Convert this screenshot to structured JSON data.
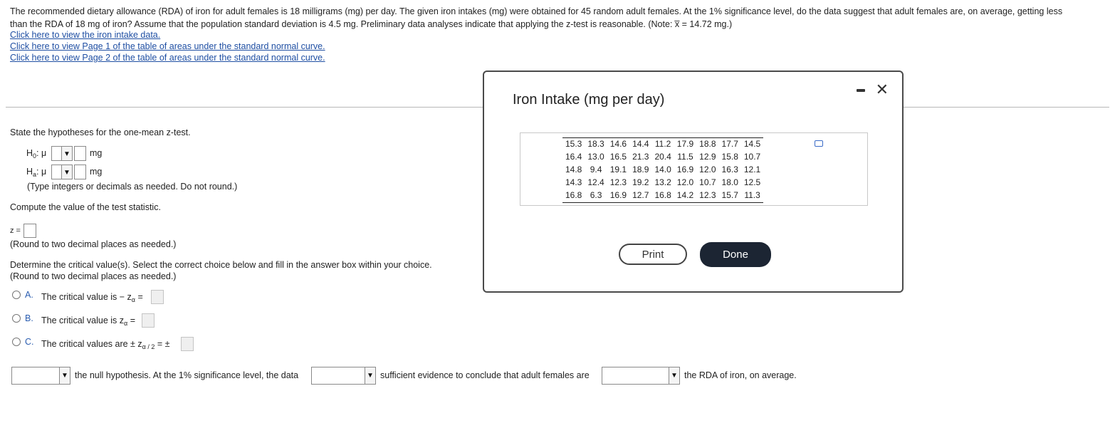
{
  "problem": {
    "text_line1": "The recommended dietary allowance (RDA) of iron for adult females is 18 milligrams (mg) per day. The given iron intakes (mg) were obtained for 45 random adult females. At the 1% significance level, do the data suggest that adult females are, on average, getting less",
    "text_line2": "than the RDA of 18 mg of iron? Assume that the population standard deviation is 4.5 mg. Preliminary data analyses indicate that applying the z-test is reasonable. (Note: x̅ = 14.72 mg.)",
    "links": [
      "Click here to view the iron intake data.",
      "Click here to view Page 1 of the table of areas under the standard normal curve.",
      "Click here to view Page 2 of the table of areas under the standard normal curve."
    ]
  },
  "hypotheses": {
    "prompt": "State the hypotheses for the one-mean z-test.",
    "h0_label": "H",
    "h0_sub": "0",
    "ha_label": "H",
    "ha_sub": "a",
    "mu_symbol": ": μ",
    "unit": "mg",
    "note": "(Type integers or decimals as needed. Do not round.)"
  },
  "test_statistic": {
    "prompt": "Compute the value of the test statistic.",
    "label": "z =",
    "note": "(Round to two decimal places as needed.)"
  },
  "critical": {
    "prompt": "Determine the critical value(s). Select the correct choice below and fill in the answer box within your choice.",
    "note": "(Round to two decimal places as needed.)",
    "options": [
      {
        "letter": "A.",
        "text": "The critical value is  − z",
        "sub": "α",
        "suffix": " ="
      },
      {
        "letter": "B.",
        "text": "The critical value is z",
        "sub": "α",
        "suffix": " ="
      },
      {
        "letter": "C.",
        "text": "The critical values are  ± z",
        "sub": "α / 2",
        "suffix": " = ±"
      }
    ]
  },
  "conclusion": {
    "part1": "the null hypothesis. At the 1% significance level, the data",
    "part2": "sufficient evidence to conclude that adult females are",
    "part3": "the RDA of iron, on average."
  },
  "modal": {
    "title": "Iron Intake (mg per day)",
    "print_label": "Print",
    "done_label": "Done",
    "rows": [
      [
        "15.3",
        "18.3",
        "14.6",
        "14.4",
        "11.2",
        "17.9",
        "18.8",
        "17.7",
        "14.5"
      ],
      [
        "16.4",
        "13.0",
        "16.5",
        "21.3",
        "20.4",
        "11.5",
        "12.9",
        "15.8",
        "10.7"
      ],
      [
        "14.8",
        "9.4",
        "19.1",
        "18.9",
        "14.0",
        "16.9",
        "12.0",
        "16.3",
        "12.1"
      ],
      [
        "14.3",
        "12.4",
        "12.3",
        "19.2",
        "13.2",
        "12.0",
        "10.7",
        "18.0",
        "12.5"
      ],
      [
        "16.8",
        "6.3",
        "16.9",
        "12.7",
        "16.8",
        "14.2",
        "12.3",
        "15.7",
        "11.3"
      ]
    ]
  },
  "icons": {
    "dropdown_arrow": "▼",
    "close": "✕"
  }
}
